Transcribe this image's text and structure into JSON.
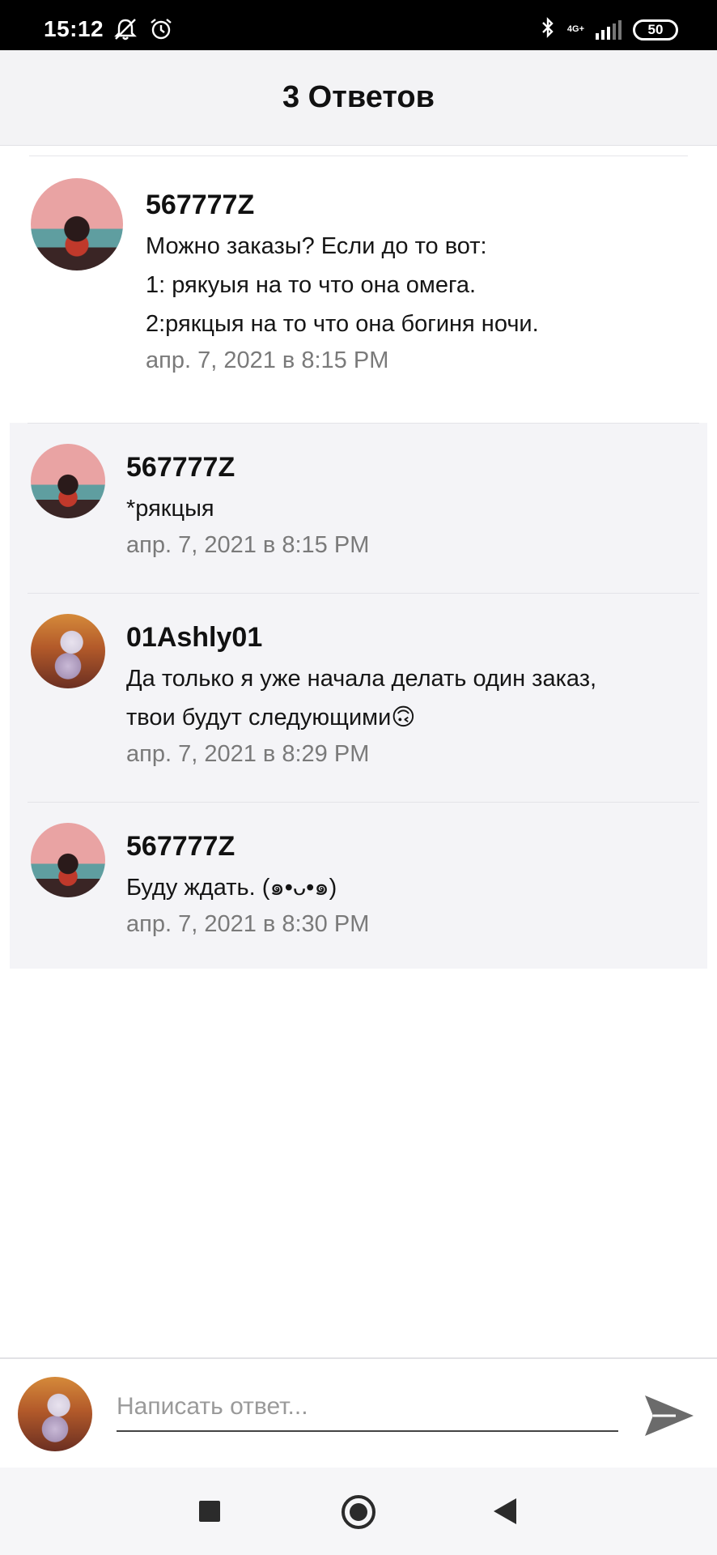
{
  "status_bar": {
    "time": "15:12",
    "network_label": "4G+",
    "battery": "50",
    "icons": [
      "bell-off-icon",
      "alarm-icon",
      "bluetooth-icon",
      "signal-icon",
      "battery-icon"
    ]
  },
  "header": {
    "title": "3 Ответов"
  },
  "main_comment": {
    "username": "567777Z",
    "lines": [
      "Можно заказы? Если до то вот:",
      "1: рякуыя на то что она омега.",
      "2:рякцыя на то что она богиня ночи."
    ],
    "timestamp": "апр. 7, 2021 в 8:15 PM"
  },
  "replies": [
    {
      "username": "567777Z",
      "lines": [
        "*рякцыя"
      ],
      "timestamp": "апр. 7, 2021 в 8:15 PM"
    },
    {
      "username": "01Ashly01",
      "lines": [
        "Да только я уже начала делать один заказ,",
        "твои будут следующими🙃"
      ],
      "timestamp": "апр. 7, 2021 в 8:29 PM"
    },
    {
      "username": "567777Z",
      "lines": [
        "Буду ждать. (๑•ᴗ•๑)"
      ],
      "timestamp": "апр. 7, 2021 в 8:30 PM"
    }
  ],
  "composer": {
    "placeholder": "Написать ответ...",
    "value": ""
  },
  "colors": {
    "header_bg": "#f3f3f5",
    "replies_bg": "#f4f4f7",
    "timestamp": "#7a7a7a",
    "send_icon": "#6b6b6b"
  }
}
